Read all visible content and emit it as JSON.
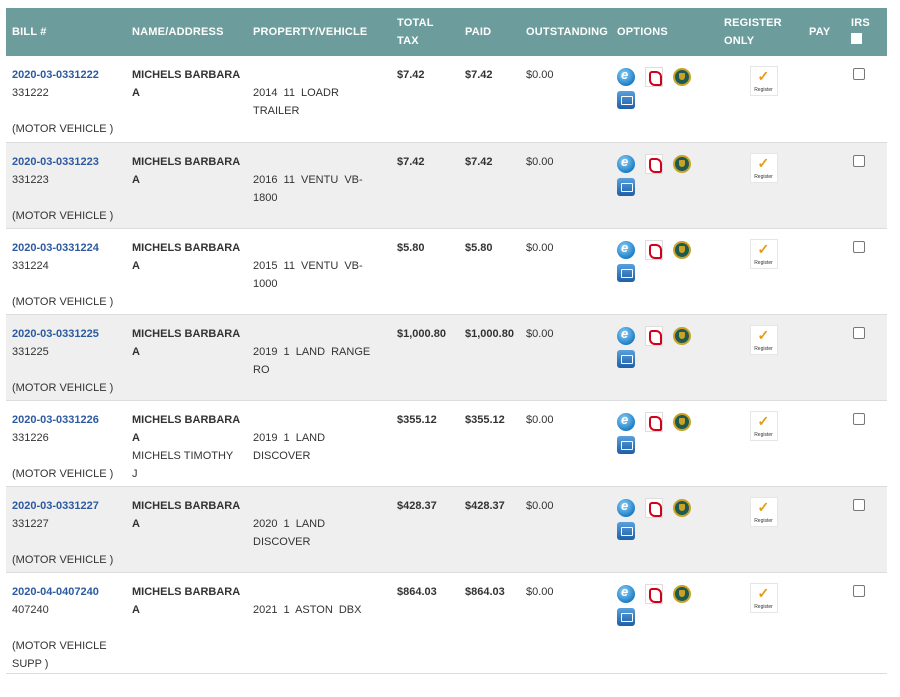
{
  "headers": {
    "bill": "BILL #",
    "name": "NAME/ADDRESS",
    "property": "PROPERTY/VEHICLE",
    "total_tax_1": "TOTAL",
    "total_tax_2": "TAX",
    "paid": "PAID",
    "outstanding": "OUTSTANDING",
    "options": "OPTIONS",
    "register_1": "REGISTER",
    "register_2": "ONLY",
    "pay": "PAY",
    "irs": "IRS"
  },
  "register_label": "Register",
  "icons": [
    "ie-view-icon",
    "pdf-icon",
    "seal-icon",
    "print-icon",
    "register-icon"
  ],
  "rows": [
    {
      "bill": "2020-03-0331222",
      "num": "331222",
      "type": "(MOTOR VEHICLE )",
      "name1": "MICHELS BARBARA",
      "name2": "A",
      "name3": "",
      "prop1": "2014 11 LOADR",
      "prop2": "TRAILER",
      "total": "$7.42",
      "paid": "$7.42",
      "out": "$0.00"
    },
    {
      "bill": "2020-03-0331223",
      "num": "331223",
      "type": "(MOTOR VEHICLE )",
      "name1": "MICHELS BARBARA",
      "name2": "A",
      "name3": "",
      "prop1": "2016 11 VENTU VB-",
      "prop2": "1800",
      "total": "$7.42",
      "paid": "$7.42",
      "out": "$0.00"
    },
    {
      "bill": "2020-03-0331224",
      "num": "331224",
      "type": "(MOTOR VEHICLE )",
      "name1": "MICHELS BARBARA",
      "name2": "A",
      "name3": "",
      "prop1": "2015 11 VENTU VB-",
      "prop2": "1000",
      "total": "$5.80",
      "paid": "$5.80",
      "out": "$0.00"
    },
    {
      "bill": "2020-03-0331225",
      "num": "331225",
      "type": "(MOTOR VEHICLE )",
      "name1": "MICHELS BARBARA",
      "name2": "A",
      "name3": "",
      "prop1": "2019 1 LAND RANGE",
      "prop2": "RO",
      "total": "$1,000.80",
      "paid": "$1,000.80",
      "out": "$0.00"
    },
    {
      "bill": "2020-03-0331226",
      "num": "331226",
      "type": "(MOTOR VEHICLE )",
      "name1": "MICHELS BARBARA",
      "name2": "A",
      "name3": "MICHELS TIMOTHY J",
      "prop1": "2019 1 LAND",
      "prop2": "DISCOVER",
      "total": "$355.12",
      "paid": "$355.12",
      "out": "$0.00"
    },
    {
      "bill": "2020-03-0331227",
      "num": "331227",
      "type": "(MOTOR VEHICLE )",
      "name1": "MICHELS BARBARA",
      "name2": "A",
      "name3": "",
      "prop1": "2020 1 LAND",
      "prop2": "DISCOVER",
      "total": "$428.37",
      "paid": "$428.37",
      "out": "$0.00"
    },
    {
      "bill": "2020-04-0407240",
      "num": "407240",
      "type": "(MOTOR VEHICLE SUPP )",
      "name1": "MICHELS BARBARA",
      "name2": "A",
      "name3": "",
      "prop1": "2021 1 ASTON DBX",
      "prop2": "",
      "total": "$864.03",
      "paid": "$864.03",
      "out": "$0.00"
    }
  ]
}
